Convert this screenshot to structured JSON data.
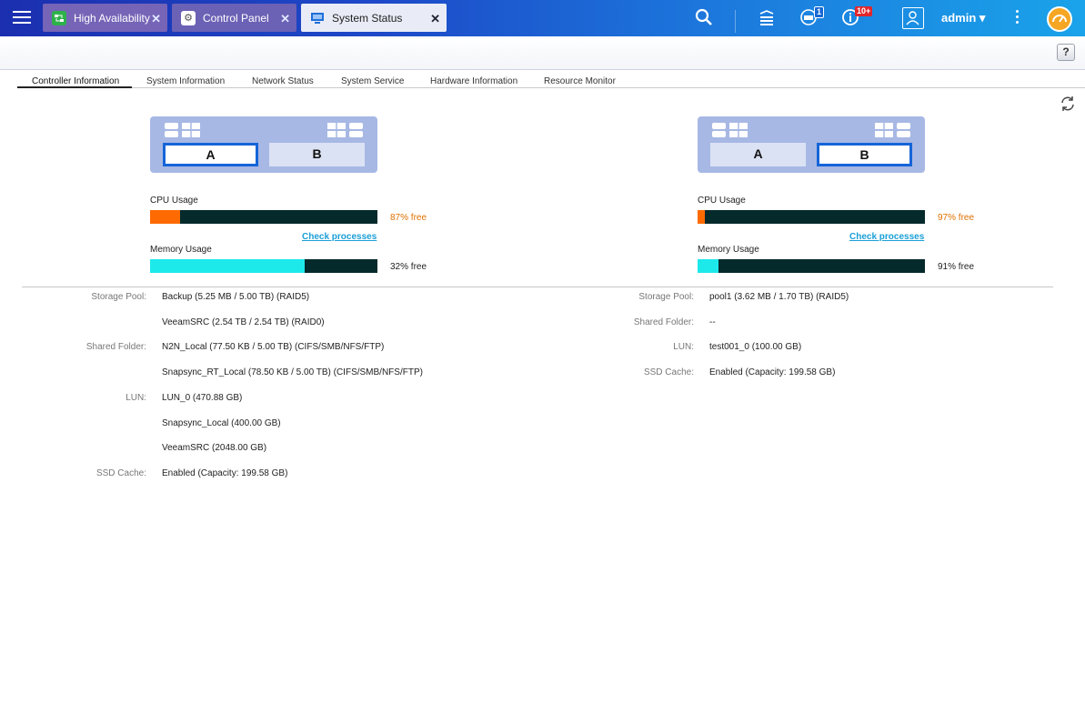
{
  "topbar": {
    "tabs": [
      {
        "label": "High Availability"
      },
      {
        "label": "Control Panel"
      },
      {
        "label": "System Status"
      }
    ],
    "notification_count": "1",
    "info_count": "10+",
    "user": "admin ▾"
  },
  "subheader": {
    "help": "?"
  },
  "subtabs": [
    "Controller Information",
    "System Information",
    "Network Status",
    "System Service",
    "Hardware Information",
    "Resource Monitor"
  ],
  "controllers": [
    {
      "slot_a": "A",
      "slot_b": "B",
      "active": "A",
      "cpu_label": "CPU Usage",
      "cpu_used_fraction": 0.13,
      "cpu_free": "87% free",
      "check_processes": "Check processes",
      "mem_label": "Memory Usage",
      "mem_used_fraction": 0.68,
      "mem_free": "32% free",
      "storage_pool_label": "Storage Pool:",
      "storage_pools": [
        "Backup (5.25 MB / 5.00 TB) (RAID5)",
        "VeeamSRC (2.54 TB / 2.54 TB) (RAID0)"
      ],
      "shared_folder_label": "Shared Folder:",
      "shared_folders": [
        "N2N_Local (77.50 KB / 5.00 TB) (CIFS/SMB/NFS/FTP)",
        "Snapsync_RT_Local (78.50 KB / 5.00 TB) (CIFS/SMB/NFS/FTP)"
      ],
      "lun_label": "LUN:",
      "luns": [
        "LUN_0 (470.88 GB)",
        "Snapsync_Local (400.00 GB)",
        "VeeamSRC (2048.00 GB)"
      ],
      "ssd_label": "SSD Cache:",
      "ssd_cache": "Enabled (Capacity: 199.58 GB)"
    },
    {
      "slot_a": "A",
      "slot_b": "B",
      "active": "B",
      "cpu_label": "CPU Usage",
      "cpu_used_fraction": 0.03,
      "cpu_free": "97% free",
      "check_processes": "Check processes",
      "mem_label": "Memory Usage",
      "mem_used_fraction": 0.09,
      "mem_free": "91% free",
      "storage_pool_label": "Storage Pool:",
      "storage_pools": [
        "pool1 (3.62 MB / 1.70 TB) (RAID5)"
      ],
      "shared_folder_label": "Shared Folder:",
      "shared_folders": [
        "--"
      ],
      "lun_label": "LUN:",
      "luns": [
        "test001_0 (100.00 GB)"
      ],
      "ssd_label": "SSD Cache:",
      "ssd_cache": "Enabled (Capacity: 199.58 GB)"
    }
  ],
  "colors": {
    "cpu_fill": "#ff6a00",
    "mem_fill": "#1de9ea",
    "bar_bg": "#052a2c",
    "active_slot": "#1565d8"
  }
}
